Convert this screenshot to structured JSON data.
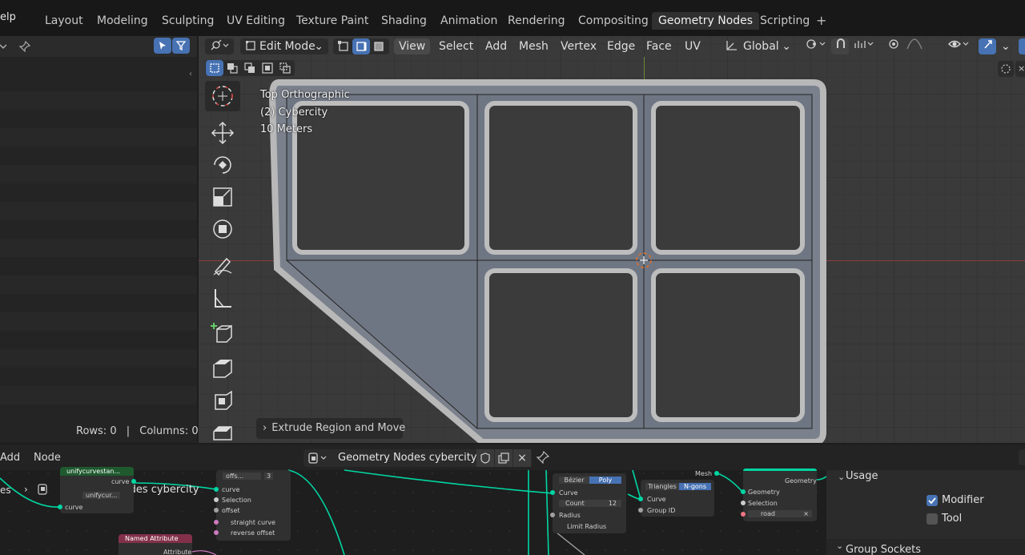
{
  "topbar": {
    "help_menu": "elp",
    "workspaces": [
      "Layout",
      "Modeling",
      "Sculpting",
      "UV Editing",
      "Texture Paint",
      "Shading",
      "Animation",
      "Rendering",
      "Compositing",
      "Geometry Nodes",
      "Scripting"
    ],
    "active_workspace": "Geometry Nodes",
    "add_workspace": "+"
  },
  "outliner": {
    "rows_label": "Rows: 0",
    "separator": "|",
    "columns_label": "Columns: 0"
  },
  "viewport": {
    "mode": "Edit Mode",
    "menus": [
      "View",
      "Select",
      "Add",
      "Mesh",
      "Vertex",
      "Edge",
      "Face",
      "UV"
    ],
    "active_menu": "View",
    "transform_orientation": "Global",
    "overlay_view": "Top Orthographic",
    "overlay_object": "(2) Cybercity",
    "overlay_scale": "10 Meters",
    "redo_panel": "Extrude Region and Move"
  },
  "node_editor": {
    "menus": [
      "Add",
      "Node"
    ],
    "node_group": "Geometry Nodes cybercity",
    "breadcrumb": "Geometry Nodes cybercity",
    "breadcrumb_prefix": "es",
    "nodes": {
      "unify_title": "unifycurvestan...",
      "unify_sub": "unifycur...",
      "unify_curve_out": "curve",
      "unify_curve_in": "curve",
      "offset_title": "offs...",
      "offset_count": "3",
      "offset_curve": "curve",
      "offset_selection": "Selection",
      "offset_offset": "offset",
      "offset_straight": "straight curve",
      "offset_reverse": "reverse offset",
      "named_attr_title": "Named Attribute",
      "named_attr_out": "Attribute",
      "resample_bezier": "Bézier",
      "resample_poly": "Poly",
      "resample_curve": "Curve",
      "resample_count_label": "Count",
      "resample_count_value": "12",
      "resample_radius": "Radius",
      "resample_limit": "Limit Radius",
      "fill_triangles": "Triangles",
      "fill_ngons": "N-gons",
      "fill_curve": "Curve",
      "fill_group": "Group ID",
      "fill_mesh_out": "Mesh",
      "setmat_geometry": "Geometry",
      "setmat_selection": "Selection",
      "setmat_material": "road",
      "output_geometry": "Geometry"
    }
  },
  "properties": {
    "usage_title": "Usage",
    "modifier_label": "Modifier",
    "tool_label": "Tool",
    "group_sockets_title": "Group Sockets"
  },
  "colors": {
    "accent_blue": "#4772b3",
    "socket_geometry": "#00d6a3",
    "socket_float": "#a1a1a1",
    "socket_material": "#eb7582",
    "named_attr_header": "#83314a",
    "active_tab": "#303030"
  }
}
